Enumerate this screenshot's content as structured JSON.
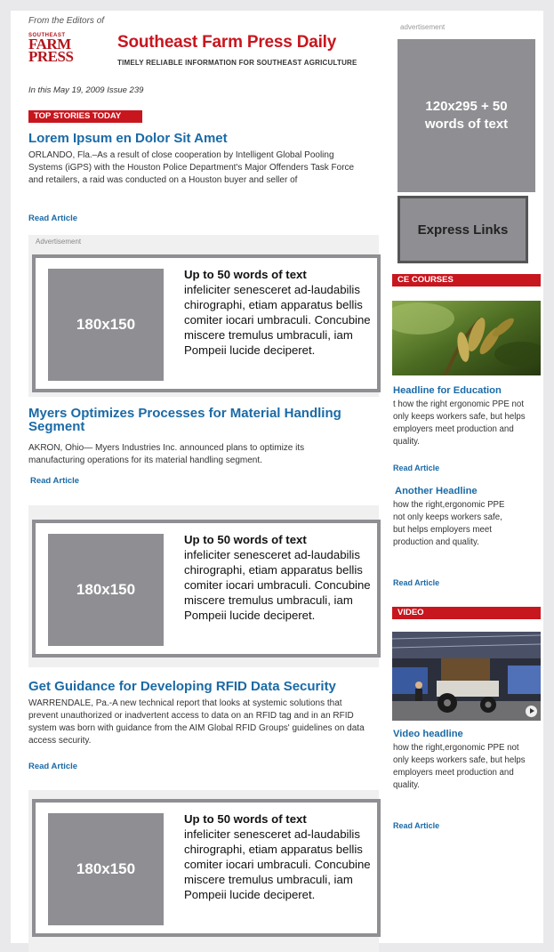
{
  "header": {
    "from_editors": "From the Editors of",
    "logo_small": "SOUTHEAST",
    "logo_line1": "FARM",
    "logo_line2": "PRESS",
    "title": "Southeast Farm Press Daily",
    "tagline": "TIMELY RELIABLE INFORMATION FOR SOUTHEAST AGRICULTURE",
    "issue": "In this May 19, 2009 Issue 239"
  },
  "top_stories": {
    "label": "TOP STORIES TODAY"
  },
  "articles": [
    {
      "headline": "Lorem Ipsum en Dolor Sit Amet",
      "body": "ORLANDO, Fla.–As a result of close cooperation by Intelligent Global Pooling Systems (iGPS) with the Houston Police Department's Major Offenders Task Force and retailers, a raid was conducted on a Houston buyer and seller of",
      "link": "Read Article"
    },
    {
      "headline": "Myers Optimizes Processes for Material Handling Segment",
      "body": "AKRON, Ohio— Myers Industries Inc. announced plans to optimize its manufacturing operations for its material handling segment.",
      "link": "Read Article"
    },
    {
      "headline": "Get Guidance for Developing RFID Data Security",
      "body": "WARRENDALE, Pa.-A new technical report that looks at systemic solutions that prevent unauthorized or inadvertent access to data on an RFID tag and in an RFID system was born with guidance from the AIM Global RFID Groups' guidelines on data access security.",
      "link": "Read Article"
    }
  ],
  "ads": [
    {
      "label": "Advertisement",
      "image_text": "180x150",
      "heading": "Up to 50 words of text",
      "body": "infeliciter senesceret ad-laudabilis chirographi, etiam apparatus bellis comiter iocari umbraculi. Concubine miscere tremulus umbraculi, iam Pompeii lucide deciperet."
    },
    {
      "label": "",
      "image_text": "180x150",
      "heading": "Up to 50 words of text",
      "body": "infeliciter senesceret ad-laudabilis chirographi, etiam apparatus bellis comiter iocari umbraculi. Concubine miscere tremulus umbraculi, iam Pompeii lucide deciperet."
    },
    {
      "label": "",
      "image_text": "180x150",
      "heading": "Up to 50 words of text",
      "body": "infeliciter senesceret ad-laudabilis chirographi, etiam apparatus bellis comiter iocari umbraculi. Concubine miscere tremulus umbraculi, iam Pompeii lucide deciperet."
    }
  ],
  "sidebar": {
    "ad_label": "advertisement",
    "ad_text": "120x295 + 50 words of text",
    "express_links": "Express Links",
    "ce_courses": {
      "label": "CE COURSES",
      "item1_headline": "Headline for Education",
      "item1_body": "t how the right ergonomic PPE not only keeps workers safe, but helps employers meet production and quality.",
      "item1_link": "Read Article",
      "item2_headline": "Another Headline",
      "item2_body": "how the right,ergonomic PPE not only keeps workers safe, but helps employers meet production and quality.",
      "item2_link": "Read Article"
    },
    "video": {
      "label": "VIDEO",
      "headline": "Video headline",
      "body": "how the right,ergonomic PPE not only keeps workers safe, but helps employers meet production and quality.",
      "link": "Read Article"
    }
  },
  "colors": {
    "brand_red": "#c8161e",
    "link_blue": "#1a6aa6",
    "placeholder_gray": "#8e8e93"
  }
}
